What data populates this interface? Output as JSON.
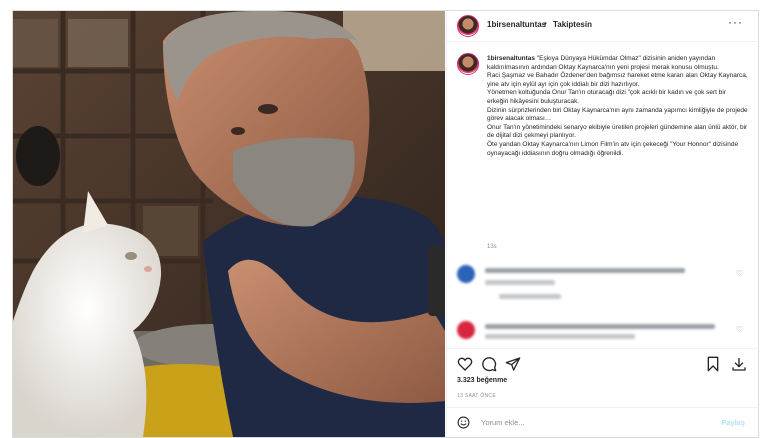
{
  "post": {
    "username": "1birsenaltuntas",
    "dot": "•",
    "follow_label": "Takiptesin",
    "more_label": "···",
    "caption": [
      "\"Eşkıya Dünyaya Hükümdar Olmaz\" dizisinin aniden yayından kaldırılmasının ardından Oktay Kaynarca'nın yeni projesi merak konusu olmuştu.",
      "Raci Şaşmaz ve Bahadır Özdener'den bağımsız hareket etme kararı alan Oktay Kaynarca, yine atv için eylül ayı için çok iddialı bir dizi hazırlıyor.",
      "Yönetmen koltuğunda Onur Tan'ın oturacağı dizi \"çok acıklı bir kadın ve çok sert bir erkeğin hikâyesini buluşturacak.",
      "Dizinin sürprizlerinden biri Oktay Kaynarca'nın aynı zamanda yapımcı kimliğiyle de projede görev alacak olması…",
      "Onur Tan'ın yönetimindeki senaryo ekibiyle üretilen projeleri gündemine alan ünlü aktör, bir de dijital dizi çekmeyi planlıyor.",
      "Öte yandan Oktay Kaynarca'nın Limon Film'in atv için çekeceği \"Your Honnor\" dizisinde oynayacağı iddiasının doğru olmadığı öğrenildi."
    ],
    "caption_time": "13s",
    "likes": "3.323 beğenme",
    "time_ago": "13 SAAT ÖNCE",
    "add_comment_placeholder": "Yorum ekle...",
    "post_label": "Paylaş"
  },
  "colors": {
    "border": "#dbdbdb",
    "muted": "#8e8e8e",
    "post_button": "#b2dffc"
  },
  "icons": [
    "heart-icon",
    "comment-icon",
    "share-icon",
    "bookmark-icon",
    "download-icon",
    "smiley-icon",
    "more-icon"
  ]
}
